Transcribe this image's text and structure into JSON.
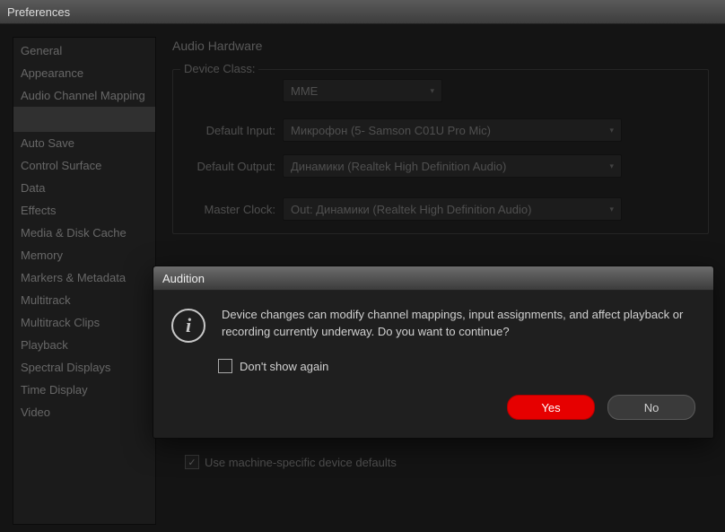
{
  "pref_window": {
    "title": "Preferences"
  },
  "sidebar": {
    "items": [
      {
        "label": "General"
      },
      {
        "label": "Appearance"
      },
      {
        "label": "Audio Channel Mapping"
      },
      {
        "label": ""
      },
      {
        "label": "Auto Save"
      },
      {
        "label": "Control Surface"
      },
      {
        "label": "Data"
      },
      {
        "label": "Effects"
      },
      {
        "label": "Media & Disk Cache"
      },
      {
        "label": "Memory"
      },
      {
        "label": "Markers & Metadata"
      },
      {
        "label": "Multitrack"
      },
      {
        "label": "Multitrack Clips"
      },
      {
        "label": "Playback"
      },
      {
        "label": "Spectral Displays"
      },
      {
        "label": "Time Display"
      },
      {
        "label": "Video"
      }
    ],
    "selected_index": 3
  },
  "main": {
    "title": "Audio Hardware",
    "device_class": {
      "label": "Device Class:",
      "value": "MME"
    },
    "default_input": {
      "label": "Default Input:",
      "value": "Микрофон (5- Samson C01U Pro Mic)"
    },
    "default_output": {
      "label": "Default Output:",
      "value": "Динамики (Realtek High Definition Audio)"
    },
    "master_clock": {
      "label": "Master Clock:",
      "value": "Out: Динамики (Realtek High Definition Audio)"
    },
    "machine_specific": {
      "label": "Use machine-specific device defaults",
      "checked": true
    }
  },
  "modal": {
    "title": "Audition",
    "message": "Device changes can modify channel mappings, input assignments, and affect playback or recording currently underway.  Do you want to continue?",
    "dont_show": {
      "label": "Don't show again",
      "checked": false
    },
    "yes": "Yes",
    "no": "No"
  }
}
